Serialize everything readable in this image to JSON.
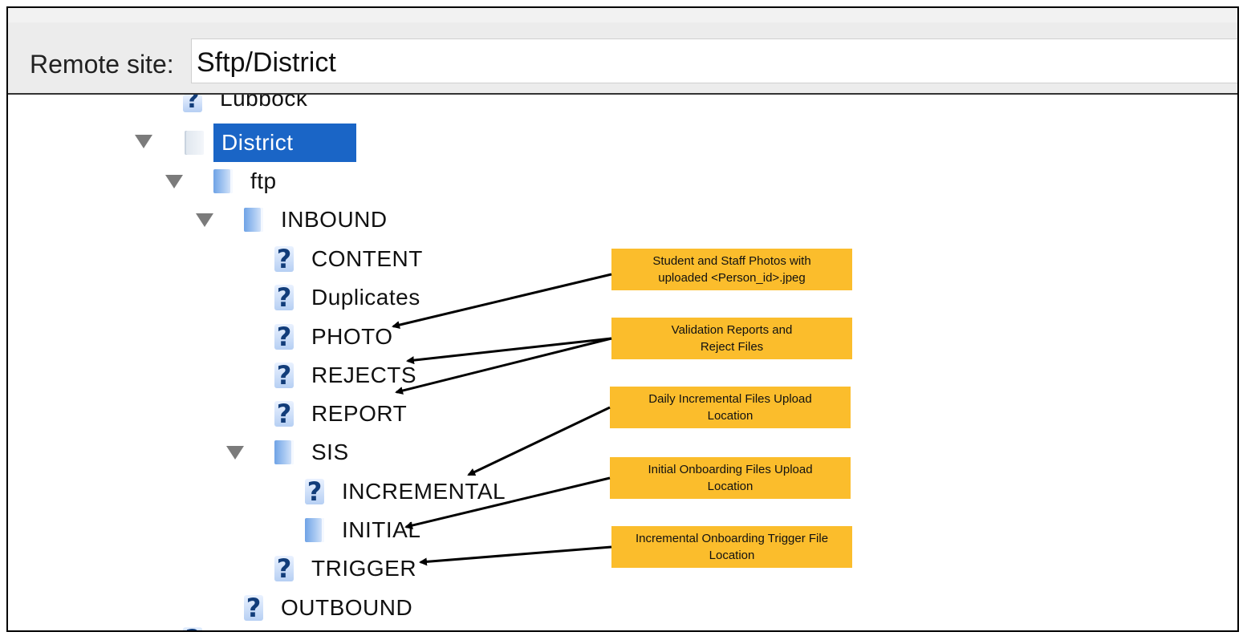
{
  "remote_site": {
    "label": "Remote site:",
    "value": "Sftp/District"
  },
  "tree": {
    "items": [
      {
        "id": "lubbock",
        "label": "Lubbock",
        "icon": "question-icon",
        "expanded": null
      },
      {
        "id": "district",
        "label": "District",
        "icon": "folder-icon",
        "expanded": true,
        "selected": true
      },
      {
        "id": "ftp",
        "label": "ftp",
        "icon": "folder-icon",
        "expanded": true
      },
      {
        "id": "inbound",
        "label": "INBOUND",
        "icon": "folder-icon",
        "expanded": true
      },
      {
        "id": "content",
        "label": "CONTENT",
        "icon": "question-icon"
      },
      {
        "id": "duplicates",
        "label": "Duplicates",
        "icon": "question-icon"
      },
      {
        "id": "photo",
        "label": "PHOTO",
        "icon": "question-icon"
      },
      {
        "id": "rejects",
        "label": "REJECTS",
        "icon": "question-icon"
      },
      {
        "id": "report",
        "label": "REPORT",
        "icon": "question-icon"
      },
      {
        "id": "sis",
        "label": "SIS",
        "icon": "folder-icon",
        "expanded": true
      },
      {
        "id": "incremental",
        "label": "INCREMENTAL",
        "icon": "question-icon"
      },
      {
        "id": "initial",
        "label": "INITIAL",
        "icon": "folder-icon"
      },
      {
        "id": "trigger",
        "label": "TRIGGER",
        "icon": "question-icon"
      },
      {
        "id": "outbound",
        "label": "OUTBOUND",
        "icon": "question-icon"
      }
    ]
  },
  "callouts": {
    "photo": {
      "line1": "Student and Staff Photos with",
      "line2": "uploaded <Person_id>.jpeg"
    },
    "reports": {
      "line1": "Validation Reports and",
      "line2": "Reject Files"
    },
    "incremental": {
      "line1": "Daily Incremental Files Upload",
      "line2": "Location"
    },
    "initial": {
      "line1": "Initial Onboarding Files Upload",
      "line2": "Location"
    },
    "trigger": {
      "line1": "Incremental Onboarding Trigger File",
      "line2": "Location"
    }
  },
  "colors": {
    "selection": "#1a65c6",
    "callout_fill": "#fbbd2c",
    "folder": "#6fa3e6",
    "question_icon": "#123d7a"
  }
}
